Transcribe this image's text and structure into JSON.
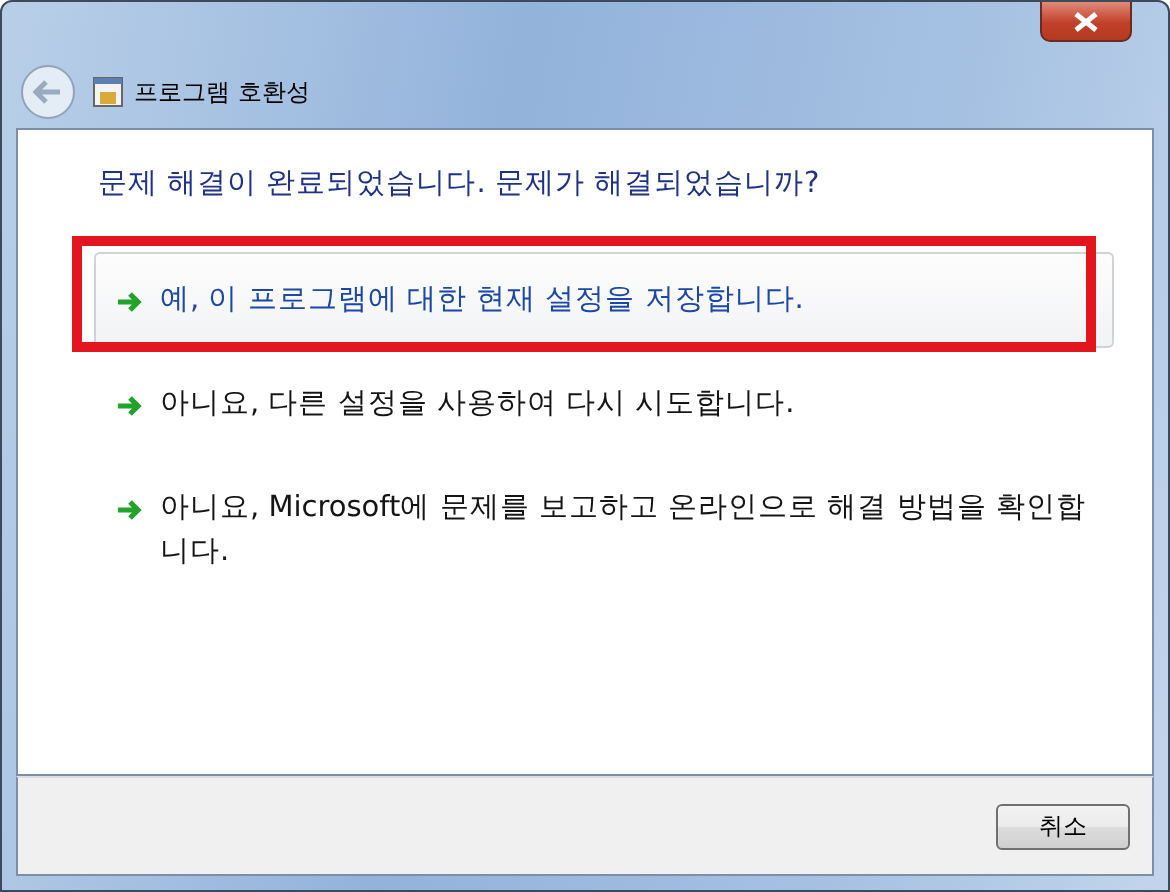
{
  "window": {
    "title": "프로그램 호환성"
  },
  "heading": "문제 해결이 완료되었습니다. 문제가 해결되었습니까?",
  "options": [
    {
      "label": "예, 이 프로그램에 대한 현재 설정을 저장합니다.",
      "selected": true,
      "highlighted": true
    },
    {
      "label": "아니요, 다른 설정을 사용하여 다시 시도합니다.",
      "selected": false,
      "highlighted": false
    },
    {
      "label": "아니요, Microsoft에 문제를 보고하고 온라인으로 해결 방법을 확인합니다.",
      "selected": false,
      "highlighted": false
    }
  ],
  "buttons": [
    "취소"
  ]
}
